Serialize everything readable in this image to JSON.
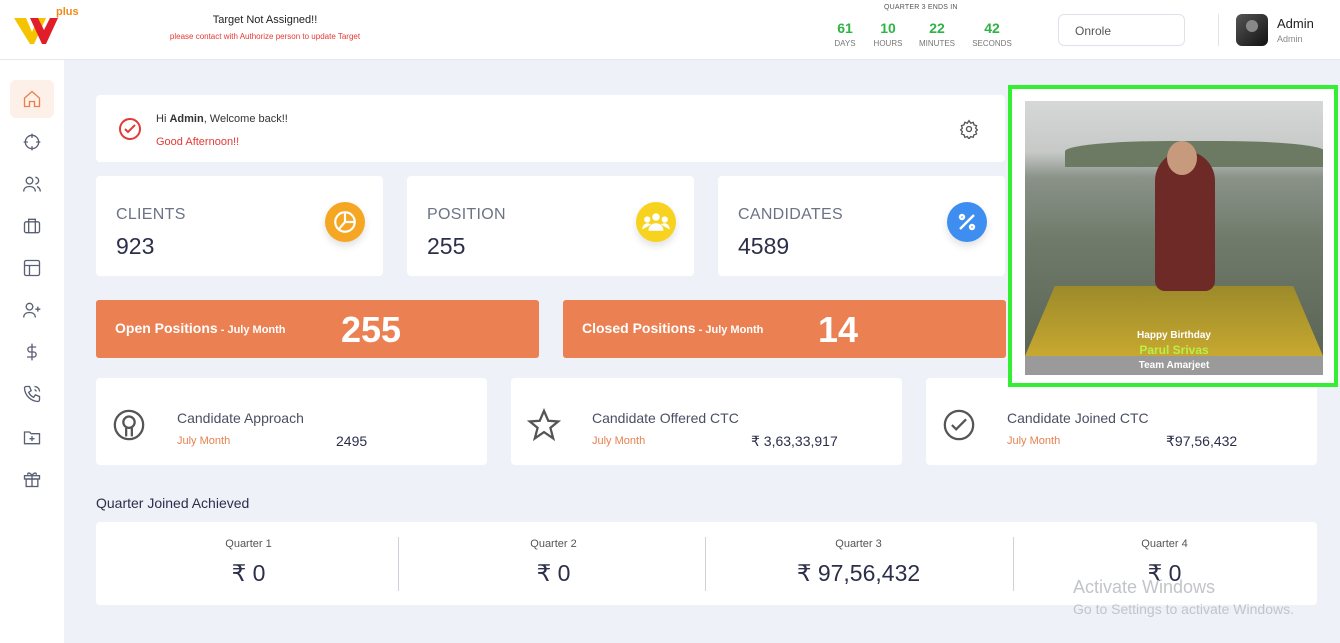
{
  "header": {
    "logo_text": "plus",
    "target_title": "Target Not Assigned!!",
    "target_sub": "please contact with Authorize person to update Target",
    "quarter_label": "QUARTER 3 ENDS IN",
    "countdown": [
      {
        "value": "61",
        "label": "DAYS"
      },
      {
        "value": "10",
        "label": "HOURS"
      },
      {
        "value": "22",
        "label": "MINUTES"
      },
      {
        "value": "42",
        "label": "SECONDS"
      }
    ],
    "company_select": "Onrole",
    "user_name": "Admin",
    "user_role": "Admin"
  },
  "sidebar": {
    "items": [
      {
        "icon": "home-icon"
      },
      {
        "icon": "target-icon"
      },
      {
        "icon": "users-icon"
      },
      {
        "icon": "briefcase-icon"
      },
      {
        "icon": "layout-icon"
      },
      {
        "icon": "user-plus-icon"
      },
      {
        "icon": "dollar-icon"
      },
      {
        "icon": "phone-call-icon"
      },
      {
        "icon": "folder-plus-icon"
      },
      {
        "icon": "gift-icon"
      }
    ]
  },
  "welcome": {
    "hi": "Hi",
    "name": "Admin",
    "rest": ", Welcome back!!",
    "greeting": "Good Afternoon!!"
  },
  "stats": [
    {
      "title": "CLIENTS",
      "value": "923",
      "color": "#f5a623"
    },
    {
      "title": "POSITION",
      "value": "255",
      "color": "#f7d21e"
    },
    {
      "title": "CANDIDATES",
      "value": "4589",
      "color": "#3d8ef0"
    }
  ],
  "positions": {
    "open_label": "Open Positions",
    "open_month": " - July Month",
    "open_value": "255",
    "closed_label": "Closed Positions",
    "closed_month": " - July Month",
    "closed_value": "14"
  },
  "metrics": [
    {
      "title": "Candidate Approach",
      "month": "July Month",
      "value": "2495"
    },
    {
      "title": "Candidate Offered CTC",
      "month": "July Month",
      "value": "₹ 3,63,33,917"
    },
    {
      "title": "Candidate Joined CTC",
      "month": "July Month",
      "value": "₹97,56,432"
    }
  ],
  "quarters": {
    "title": "Quarter Joined Achieved",
    "items": [
      {
        "label": "Quarter 1",
        "value": "₹ 0"
      },
      {
        "label": "Quarter 2",
        "value": "₹ 0"
      },
      {
        "label": "Quarter 3",
        "value": "₹ 97,56,432"
      },
      {
        "label": "Quarter 4",
        "value": "₹ 0"
      }
    ]
  },
  "birthday": {
    "greeting": "Happy Birthday",
    "name": "Parul Srivas",
    "team": "Team Amarjeet"
  },
  "watermark": {
    "line1": "Activate Windows",
    "line2": "Go to Settings to activate Windows."
  }
}
